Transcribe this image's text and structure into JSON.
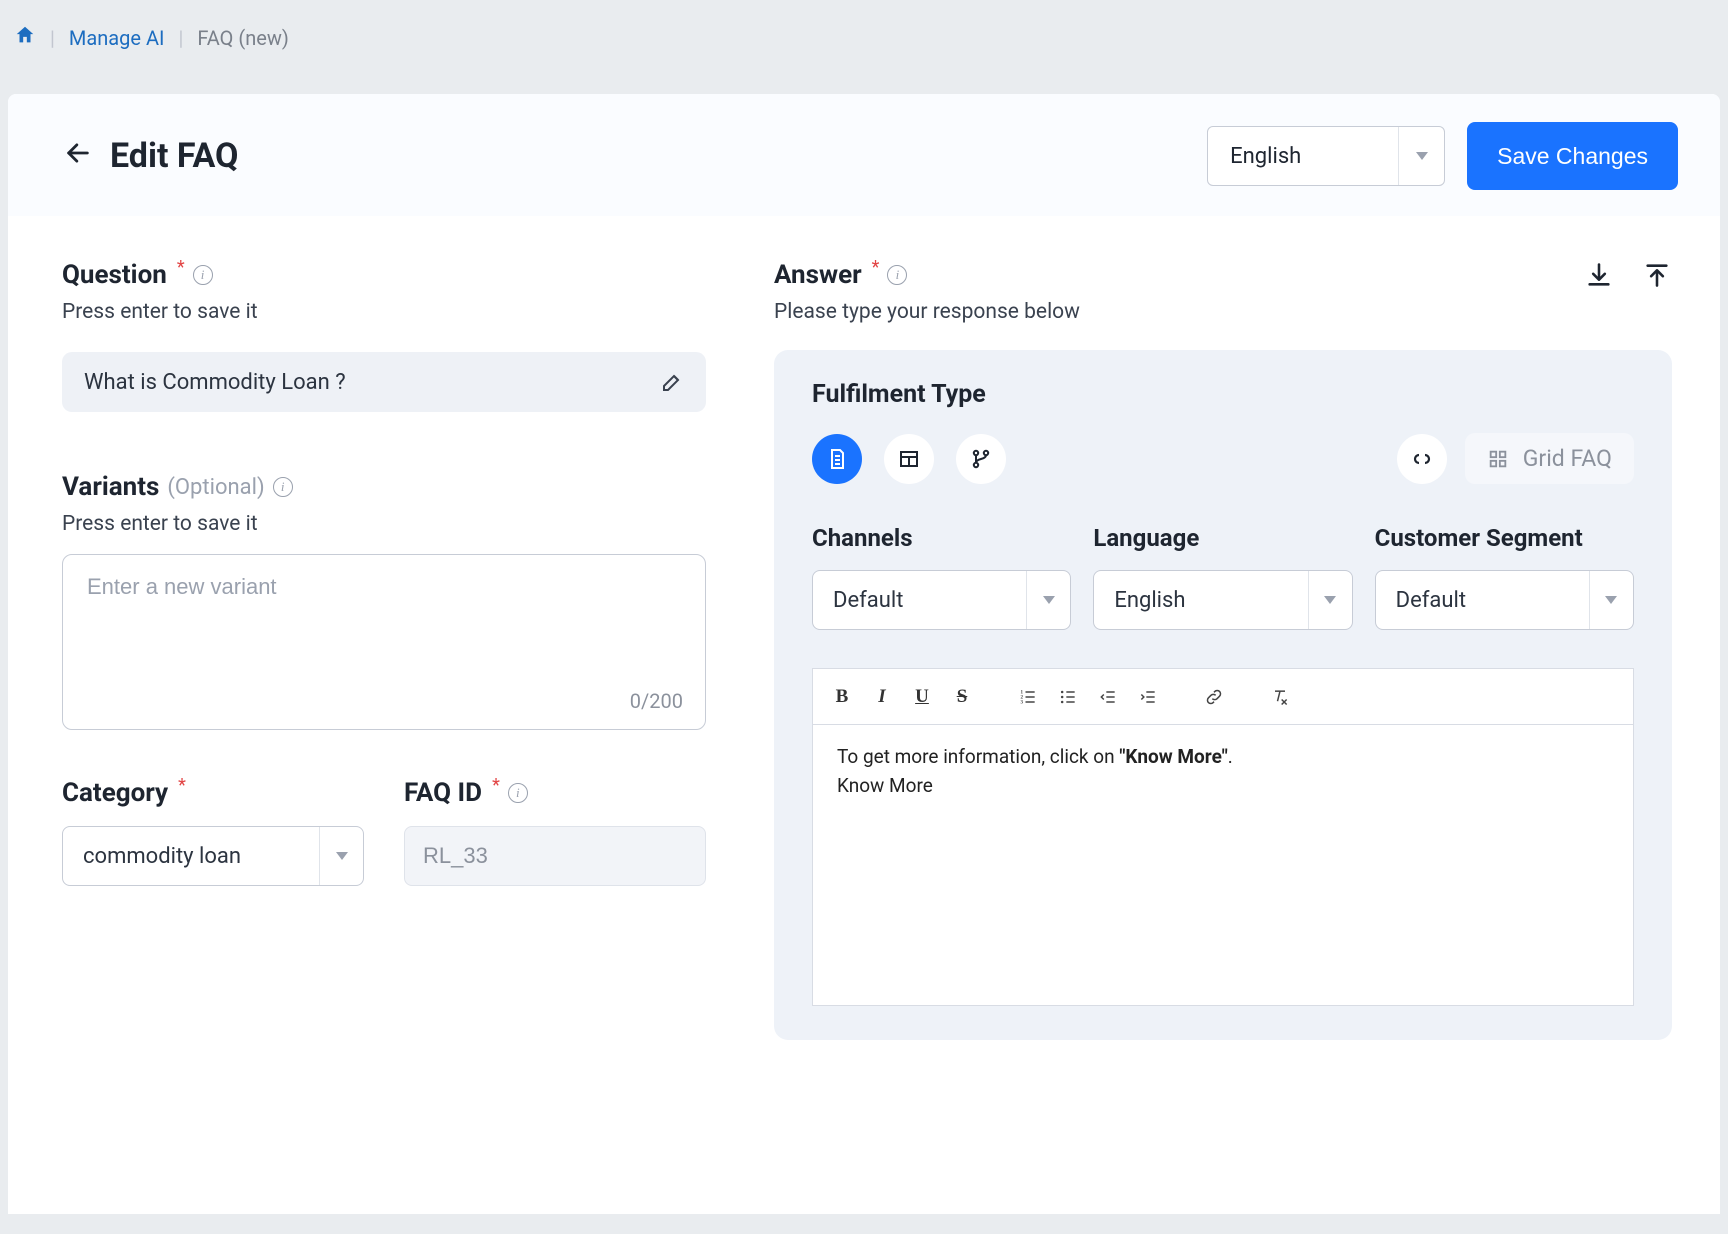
{
  "breadcrumb": {
    "manage_ai": "Manage AI",
    "current": "FAQ (new)"
  },
  "header": {
    "title": "Edit FAQ",
    "language_select": "English",
    "save_label": "Save Changes"
  },
  "question": {
    "label": "Question",
    "sublabel": "Press enter to save it",
    "value": "What is Commodity Loan ?"
  },
  "variants": {
    "label": "Variants",
    "optional_label": "(Optional)",
    "sublabel": "Press enter to save it",
    "placeholder": "Enter a new variant",
    "counter": "0/200"
  },
  "category": {
    "label": "Category",
    "value": "commodity loan"
  },
  "faq_id": {
    "label": "FAQ ID",
    "value": "RL_33"
  },
  "answer": {
    "label": "Answer",
    "sublabel": "Please type your response below"
  },
  "fulfilment": {
    "title": "Fulfilment Type",
    "grid_faq_label": "Grid FAQ",
    "channels": {
      "label": "Channels",
      "value": "Default"
    },
    "language": {
      "label": "Language",
      "value": "English"
    },
    "segment": {
      "label": "Customer Segment",
      "value": "Default"
    }
  },
  "editor": {
    "line1_pre": "To get more information, click on ",
    "line1_bold": "\"Know More\"",
    "line1_post": ".",
    "line2": "Know More"
  }
}
